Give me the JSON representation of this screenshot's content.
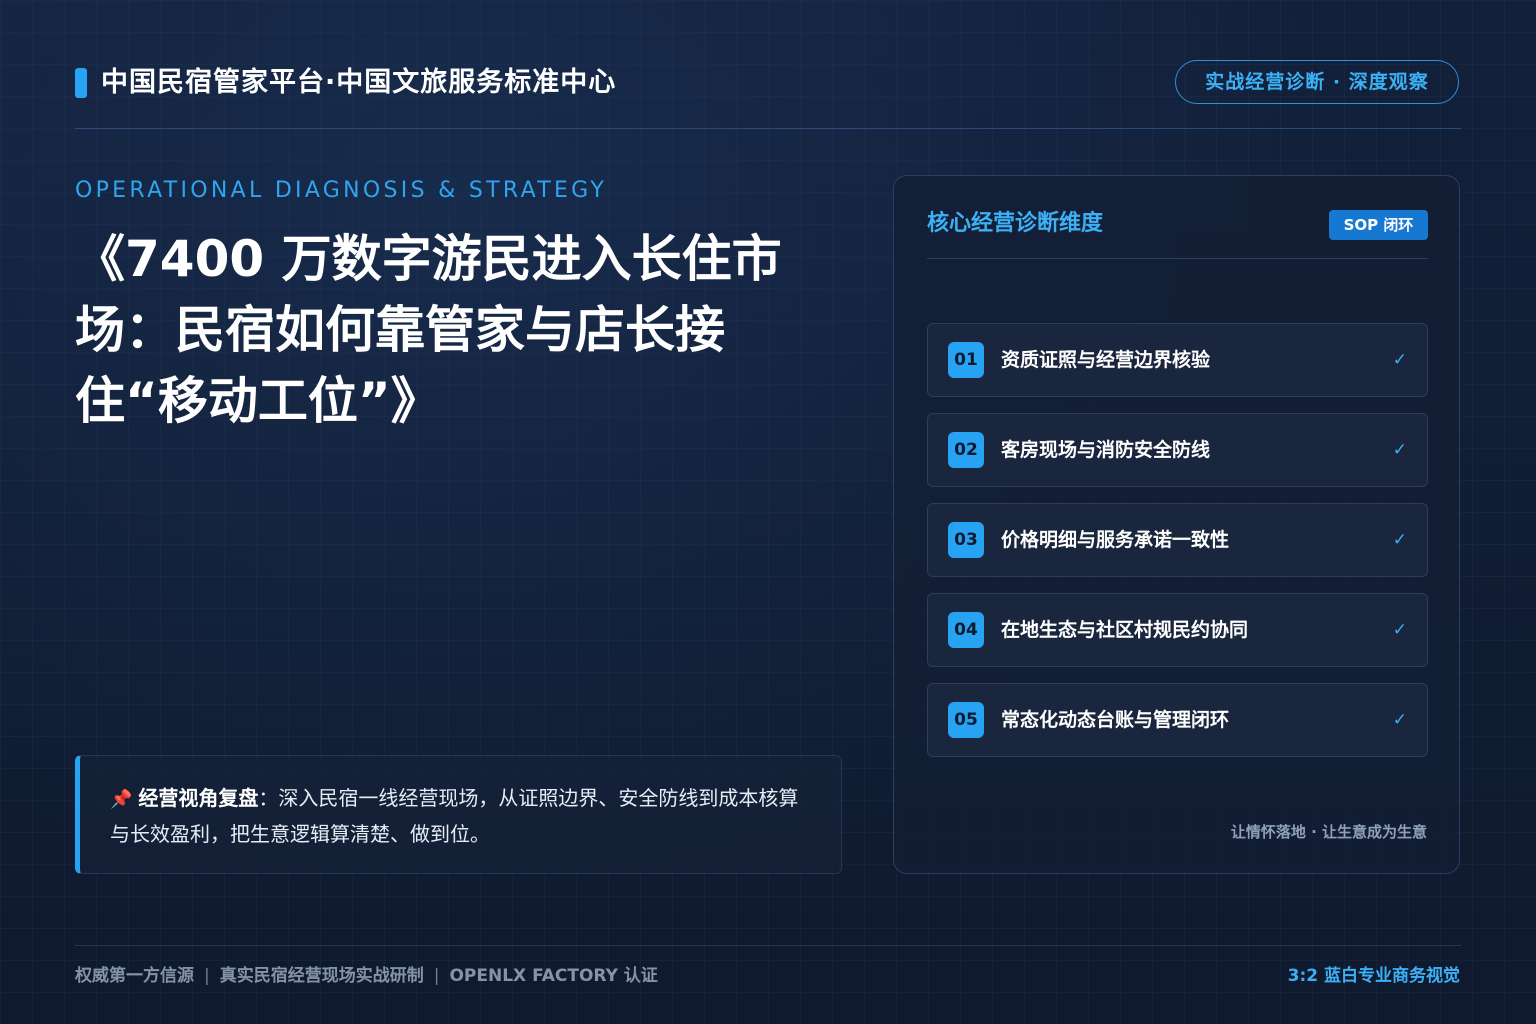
{
  "header": {
    "title": "中国民宿管家平台·中国文旅服务标准中心",
    "badge": "实战经营诊断 · 深度观察"
  },
  "hero": {
    "kicker": "OPERATIONAL DIAGNOSIS & STRATEGY",
    "headline": "《7400 万数字游民进入长住市场：民宿如何靠管家与店长接住“移动工位”》"
  },
  "note": {
    "icon": "pushpin-icon",
    "icon_glyph": "📌",
    "label": "经营视角复盘",
    "text": "：深入民宿一线经营现场，从证照边界、安全防线到成本核算与长效盈利，把生意逻辑算清楚、做到位。"
  },
  "panel": {
    "title": "核心经营诊断维度",
    "badge": "SOP 闭环",
    "items": [
      {
        "num": "01",
        "label": "资质证照与经营边界核验",
        "check": "✓"
      },
      {
        "num": "02",
        "label": "客房现场与消防安全防线",
        "check": "✓"
      },
      {
        "num": "03",
        "label": "价格明细与服务承诺一致性",
        "check": "✓"
      },
      {
        "num": "04",
        "label": "在地生态与社区村规民约协同",
        "check": "✓"
      },
      {
        "num": "05",
        "label": "常态化动态台账与管理闭环",
        "check": "✓"
      }
    ],
    "footer": "让情怀落地 · 让生意成为生意"
  },
  "footer": {
    "left_items": [
      "权威第一方信源",
      "真实民宿经营现场实战研制",
      "OPENLX FACTORY 认证"
    ],
    "separator": "|",
    "right": "3:2 蓝白专业商务视觉"
  },
  "colors": {
    "accent": "#27a3f4",
    "accent_text": "#3cb0f5",
    "background": "#111c30",
    "badge_fill": "#1678d0"
  }
}
